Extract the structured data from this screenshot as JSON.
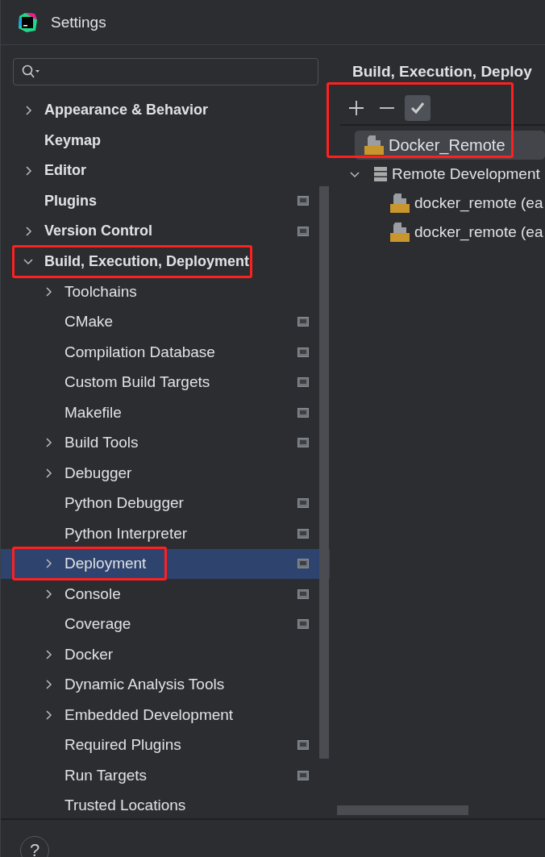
{
  "window": {
    "title": "Settings"
  },
  "sidebar": {
    "items": [
      {
        "label": "Appearance & Behavior",
        "expanded": false,
        "has_children": true,
        "project_level": false,
        "selected": false,
        "highlighted": false
      },
      {
        "label": "Keymap",
        "has_children": false,
        "project_level": false,
        "selected": false,
        "highlighted": false
      },
      {
        "label": "Editor",
        "expanded": false,
        "has_children": true,
        "project_level": false,
        "selected": false,
        "highlighted": false
      },
      {
        "label": "Plugins",
        "has_children": false,
        "project_level": true,
        "selected": false,
        "highlighted": false
      },
      {
        "label": "Version Control",
        "expanded": false,
        "has_children": true,
        "project_level": true,
        "selected": false,
        "highlighted": false
      },
      {
        "label": "Build, Execution, Deployment",
        "expanded": true,
        "has_children": true,
        "project_level": false,
        "selected": false,
        "highlighted": true,
        "children": [
          {
            "label": "Toolchains",
            "expanded": false,
            "has_children": true,
            "project_level": false,
            "selected": false,
            "highlighted": false
          },
          {
            "label": "CMake",
            "has_children": false,
            "project_level": true,
            "selected": false,
            "highlighted": false
          },
          {
            "label": "Compilation Database",
            "has_children": false,
            "project_level": true,
            "selected": false,
            "highlighted": false
          },
          {
            "label": "Custom Build Targets",
            "has_children": false,
            "project_level": true,
            "selected": false,
            "highlighted": false
          },
          {
            "label": "Makefile",
            "has_children": false,
            "project_level": true,
            "selected": false,
            "highlighted": false
          },
          {
            "label": "Build Tools",
            "expanded": false,
            "has_children": true,
            "project_level": true,
            "selected": false,
            "highlighted": false
          },
          {
            "label": "Debugger",
            "expanded": false,
            "has_children": true,
            "project_level": false,
            "selected": false,
            "highlighted": false
          },
          {
            "label": "Python Debugger",
            "has_children": false,
            "project_level": true,
            "selected": false,
            "highlighted": false
          },
          {
            "label": "Python Interpreter",
            "has_children": false,
            "project_level": true,
            "selected": false,
            "highlighted": false
          },
          {
            "label": "Deployment",
            "expanded": false,
            "has_children": true,
            "project_level": true,
            "selected": true,
            "highlighted": true
          },
          {
            "label": "Console",
            "expanded": false,
            "has_children": true,
            "project_level": true,
            "selected": false,
            "highlighted": false
          },
          {
            "label": "Coverage",
            "has_children": false,
            "project_level": true,
            "selected": false,
            "highlighted": false
          },
          {
            "label": "Docker",
            "expanded": false,
            "has_children": true,
            "project_level": false,
            "selected": false,
            "highlighted": false
          },
          {
            "label": "Dynamic Analysis Tools",
            "expanded": false,
            "has_children": true,
            "project_level": false,
            "selected": false,
            "highlighted": false
          },
          {
            "label": "Embedded Development",
            "expanded": false,
            "has_children": true,
            "project_level": false,
            "selected": false,
            "highlighted": false
          },
          {
            "label": "Required Plugins",
            "has_children": false,
            "project_level": true,
            "selected": false,
            "highlighted": false
          },
          {
            "label": "Run Targets",
            "has_children": false,
            "project_level": true,
            "selected": false,
            "highlighted": false
          },
          {
            "label": "Trusted Locations",
            "has_children": false,
            "project_level": false,
            "selected": false,
            "highlighted": false
          }
        ]
      }
    ]
  },
  "content": {
    "breadcrumb": "Build, Execution, Deploy",
    "toolbar_highlighted": true,
    "servers": [
      {
        "kind": "server",
        "label": "Docker_Remote",
        "selected": true
      },
      {
        "kind": "group",
        "label": "Remote Development",
        "expanded": true,
        "selected": false,
        "children": [
          {
            "kind": "server",
            "label": "docker_remote (ea",
            "selected": false
          },
          {
            "kind": "server",
            "label": "docker_remote (ea",
            "selected": false
          }
        ]
      }
    ]
  },
  "help_button": {
    "label": "?"
  }
}
